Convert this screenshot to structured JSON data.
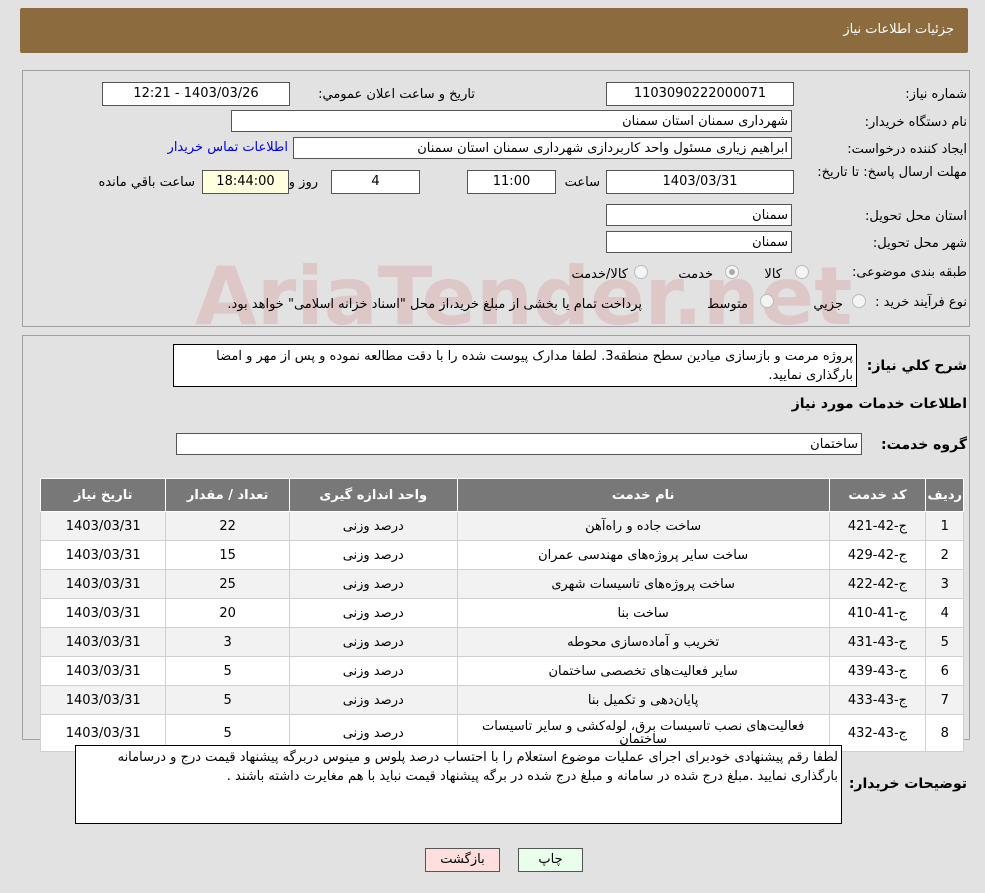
{
  "header": {
    "title": "جزئیات اطلاعات نیاز"
  },
  "fields": {
    "need_number_label": "شماره نیاز:",
    "need_number": "1103090222000071",
    "announce_label": "تاریخ و ساعت اعلان عمومي:",
    "announce_value": "1403/03/26 - 12:21",
    "buyer_org_label": "نام دستگاه خریدار:",
    "buyer_org": "شهرداری سمنان استان سمنان",
    "creator_label": "ایجاد کننده درخواست:",
    "creator": "ابراهیم زیاری مسئول واحد کاربردازی شهرداری سمنان استان سمنان",
    "contact_link": "اطلاعات تماس خریدار",
    "deadline_label": "مهلت ارسال پاسخ: تا تاریخ:",
    "deadline_date": "1403/03/31",
    "time_label": "ساعت",
    "deadline_time": "11:00",
    "days": "4",
    "days_label": "روز و",
    "remaining": "18:44:00",
    "remaining_label": "ساعت باقي مانده",
    "province_label": "استان محل تحویل:",
    "province": "سمنان",
    "city_label": "شهر محل تحویل:",
    "city": "سمنان",
    "category_label": "طبقه بندی موضوعی:",
    "category_options": [
      "کالا",
      "خدمت",
      "کالا/خدمت"
    ],
    "category_selected": "خدمت",
    "process_label": "نوع فرآیند خرید :",
    "process_options": [
      "جزيي",
      "متوسط"
    ],
    "process_note": "پرداخت تمام یا بخشی از مبلغ خرید،از محل \"اسناد خزانه اسلامی\" خواهد بود."
  },
  "watermark": "AriaTender.net",
  "description": {
    "label": "شرح کلي نیاز:",
    "text": "پروژه مرمت و بازسازی میادین سطح منطقه3. لطفا مدارک پیوست شده را با دقت مطالعه نموده و پس از مهر و امضا بارگذاری نمایید."
  },
  "services": {
    "title": "اطلاعات خدمات مورد نیاز",
    "group_label": "گروه خدمت:",
    "group": "ساختمان",
    "columns": [
      "ردیف",
      "کد خدمت",
      "نام خدمت",
      "واحد اندازه گیری",
      "تعداد / مقدار",
      "تاریخ نیاز"
    ],
    "rows": [
      [
        "1",
        "ج-42-421",
        "ساخت جاده و راه‌آهن",
        "درصد وزنی",
        "22",
        "1403/03/31"
      ],
      [
        "2",
        "ج-42-429",
        "ساخت سایر پروژه‌های مهندسی عمران",
        "درصد وزنی",
        "15",
        "1403/03/31"
      ],
      [
        "3",
        "ج-42-422",
        "ساخت پروژه‌های تاسیسات شهری",
        "درصد وزنی",
        "25",
        "1403/03/31"
      ],
      [
        "4",
        "ج-41-410",
        "ساخت بنا",
        "درصد وزنی",
        "20",
        "1403/03/31"
      ],
      [
        "5",
        "ج-43-431",
        "تخریب و آماده‌سازی محوطه",
        "درصد وزنی",
        "3",
        "1403/03/31"
      ],
      [
        "6",
        "ج-43-439",
        "سایر فعالیت‌های تخصصی ساختمان",
        "درصد وزنی",
        "5",
        "1403/03/31"
      ],
      [
        "7",
        "ج-43-433",
        "پایان‌دهی و تکمیل بنا",
        "درصد وزنی",
        "5",
        "1403/03/31"
      ],
      [
        "8",
        "ج-43-432",
        "فعالیت‌های نصب تاسیسات برق، لوله‌کشی و سایر تاسیسات ساختمان",
        "درصد وزنی",
        "5",
        "1403/03/31"
      ]
    ]
  },
  "buyer_notes": {
    "label": "توضیحات خریدار:",
    "text": "لطفا رقم پیشنهادی خودبرای اجرای عملیات موضوع استعلام را با احتساب درصد پلوس و مینوس دربرگه پیشنهاد قیمت درج و درسامانه بارگذاری نمایید .مبلغ درج شده در سامانه و مبلغ درج شده در برگه پیشنهاد قیمت نباید با هم مغایرت داشته باشند ."
  },
  "buttons": {
    "print": "چاپ",
    "back": "بازگشت"
  },
  "colors": {
    "header": "#8c6c3e",
    "print_bg": "#eaffea",
    "back_bg": "#ffdede",
    "link": "#0000ee"
  }
}
